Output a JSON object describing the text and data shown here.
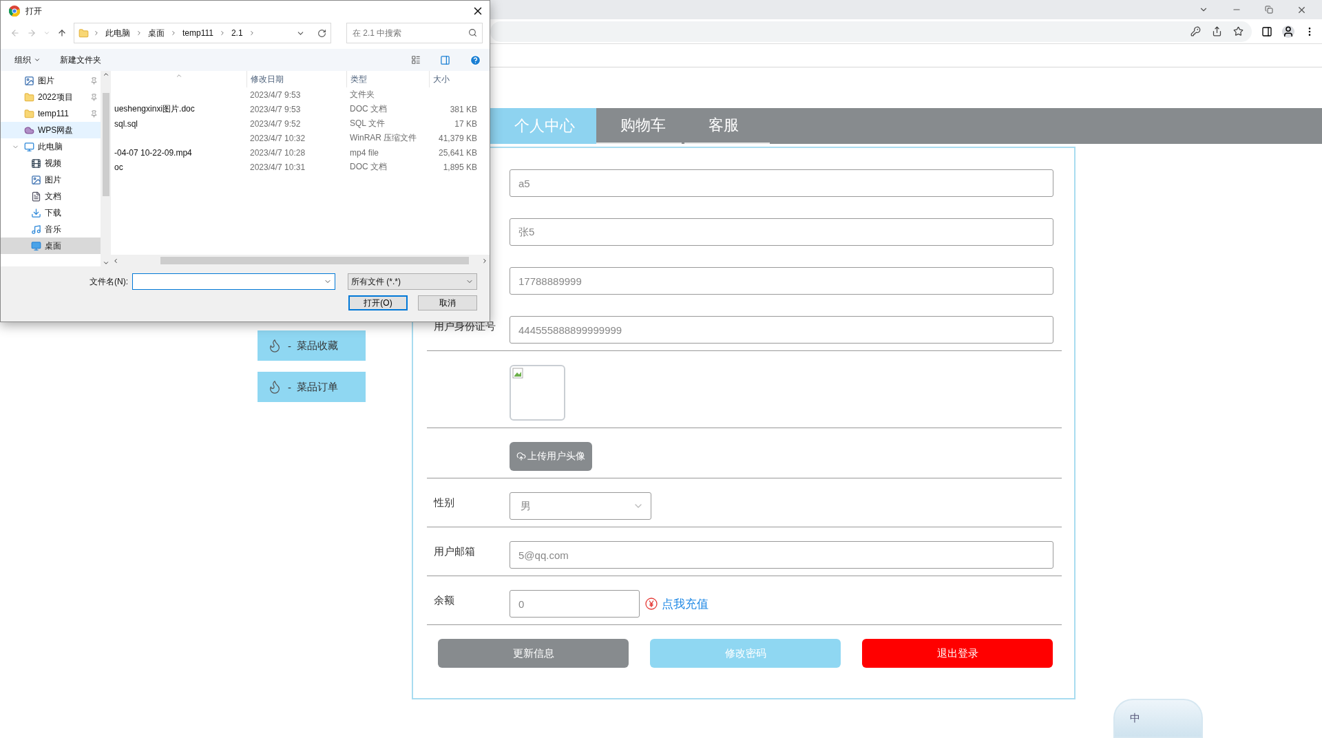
{
  "nav_tabs": [
    {
      "label": "个人中心",
      "selected": true
    },
    {
      "label": "购物车",
      "selected": false
    },
    {
      "label": "客服",
      "selected": false
    }
  ],
  "sidebar": [
    {
      "prefix": "-",
      "label": "菜品收藏"
    },
    {
      "prefix": "-",
      "label": "菜品订单"
    }
  ],
  "profile_form": {
    "rows": [
      {
        "kind": "input",
        "value": "a5",
        "divider": false
      },
      {
        "kind": "input",
        "value": "张5",
        "divider": false
      },
      {
        "kind": "input",
        "value": "17788889999",
        "divider": false
      },
      {
        "kind": "input",
        "label": "用户身份证号",
        "value": "444555888899999999",
        "divider": true
      },
      {
        "kind": "avatar",
        "divider": true
      },
      {
        "kind": "upload",
        "button": "上传用户头像",
        "divider": true
      },
      {
        "kind": "select",
        "label": "性别",
        "value": "男",
        "divider": true
      },
      {
        "kind": "input",
        "label": "用户邮箱",
        "value": "5@qq.com",
        "divider": true
      },
      {
        "kind": "balance",
        "label": "余额",
        "value": "0",
        "link": "点我充值",
        "divider": true
      }
    ],
    "buttons": [
      {
        "label": "更新信息",
        "kind": "secondary"
      },
      {
        "label": "修改密码",
        "kind": "info"
      },
      {
        "label": "退出登录",
        "kind": "danger"
      }
    ]
  },
  "ime": {
    "label": "中"
  },
  "file_dialog": {
    "title": "打开",
    "breadcrumb": [
      "此电脑",
      "桌面",
      "temp111",
      "2.1"
    ],
    "search": {
      "placeholder": "在 2.1 中搜索"
    },
    "toolbar": [
      {
        "label": "组织",
        "dropdown": true
      },
      {
        "label": "新建文件夹",
        "dropdown": false
      }
    ],
    "nav_items": [
      {
        "label": "图片",
        "kind": "picture",
        "pinned": true,
        "selected": false,
        "hovered": false
      },
      {
        "label": "2022项目",
        "kind": "folder",
        "pinned": true,
        "selected": false,
        "hovered": false
      },
      {
        "label": "temp111",
        "kind": "folder",
        "pinned": true,
        "selected": false,
        "hovered": false
      },
      {
        "label": "WPS网盘",
        "kind": "cloud",
        "pinned": false,
        "selected": false,
        "hovered": true
      },
      {
        "label": "此电脑",
        "kind": "computer",
        "pinned": false,
        "selected": false,
        "hovered": false,
        "expanded": true,
        "children": [
          {
            "label": "视频",
            "kind": "video",
            "pinned": false,
            "selected": false,
            "hovered": false
          },
          {
            "label": "图片",
            "kind": "picture",
            "pinned": false,
            "selected": false,
            "hovered": false
          },
          {
            "label": "文档",
            "kind": "document",
            "pinned": false,
            "selected": false,
            "hovered": false
          },
          {
            "label": "下载",
            "kind": "download",
            "pinned": false,
            "selected": false,
            "hovered": false
          },
          {
            "label": "音乐",
            "kind": "music",
            "pinned": false,
            "selected": false,
            "hovered": false
          },
          {
            "label": "桌面",
            "kind": "desktop",
            "pinned": false,
            "selected": true,
            "hovered": false
          }
        ]
      }
    ],
    "columns": [
      "修改日期",
      "类型",
      "大小"
    ],
    "files": [
      {
        "date": "2023/4/7 9:53",
        "type": "文件夹"
      },
      {
        "name": "ueshengxinxi图片.doc",
        "date": "2023/4/7 9:53",
        "type": "DOC 文档",
        "size": "381 KB"
      },
      {
        "name": "sql.sql",
        "date": "2023/4/7 9:52",
        "type": "SQL 文件",
        "size": "17 KB"
      },
      {
        "date": "2023/4/7 10:32",
        "type": "WinRAR 压缩文件",
        "size": "41,379 KB"
      },
      {
        "name": "-04-07 10-22-09.mp4",
        "date": "2023/4/7 10:28",
        "type": "mp4 file",
        "size": "25,641 KB"
      },
      {
        "name": "oc",
        "date": "2023/4/7 10:31",
        "type": "DOC 文档",
        "size": "1,895 KB"
      }
    ],
    "filename_label": "文件名(N):",
    "filetype": "所有文件 (*.*)",
    "buttons": [
      {
        "label": "打开(O)",
        "default": true
      },
      {
        "label": "取消",
        "default": false
      }
    ]
  }
}
